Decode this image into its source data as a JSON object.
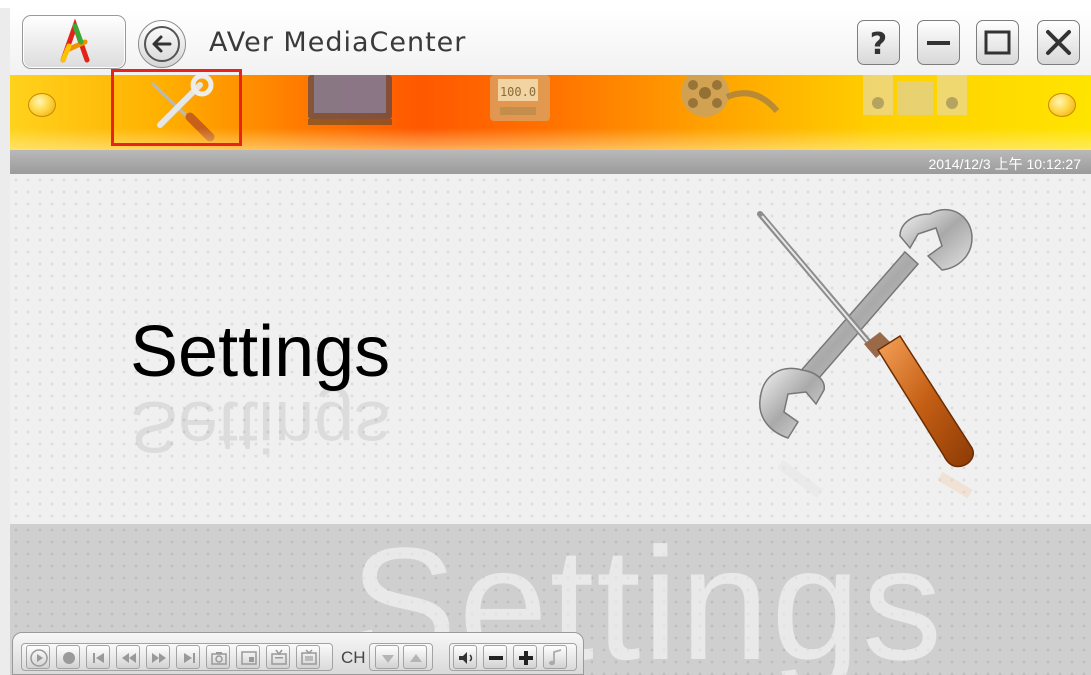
{
  "window": {
    "title": "AVer MediaCenter",
    "buttons": [
      "help-button",
      "minimize-button",
      "maximize-button",
      "close-button"
    ]
  },
  "nav": {
    "items": [
      {
        "id": "settings",
        "icon": "tools-icon",
        "selected": true
      },
      {
        "id": "tv",
        "icon": "tv-icon",
        "selected": false
      },
      {
        "id": "radio",
        "icon": "radio-icon",
        "selected": false
      },
      {
        "id": "video",
        "icon": "film-reel-icon",
        "selected": false
      },
      {
        "id": "music",
        "icon": "speakers-icon",
        "selected": false
      }
    ],
    "highlight_color": "#e8231e"
  },
  "status": {
    "clock": "2014/12/3 上午 10:12:27"
  },
  "main": {
    "title": "Settings",
    "watermark": "Settings"
  },
  "player": {
    "ch_label": "CH",
    "buttons": [
      "play-icon",
      "record-icon",
      "skip-previous-icon",
      "rewind-icon",
      "fast-forward-icon",
      "skip-next-icon",
      "snapshot-icon",
      "pip-icon",
      "teletext-icon",
      "epg-icon",
      "channel-down-icon",
      "channel-up-icon",
      "volume-icon",
      "volume-down-icon",
      "volume-up-icon",
      "audio-icon"
    ]
  },
  "colors": {
    "nav_gradient": [
      "#ffd21c",
      "#ff5800",
      "#ffe400"
    ],
    "panel_bg": "#f0f0f0",
    "clock_bar": "#a6a6a6"
  }
}
